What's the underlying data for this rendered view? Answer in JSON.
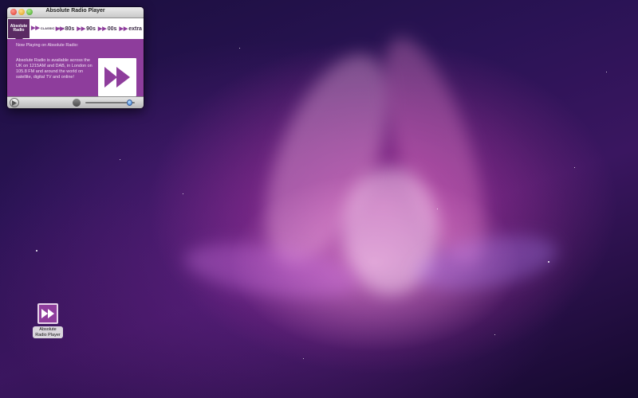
{
  "window": {
    "title": "Absolute Radio Player",
    "logo_text": "Absolute Radio",
    "stations": [
      {
        "label": "CLASSIC ROCK",
        "small": true
      },
      {
        "label": "80s",
        "small": false
      },
      {
        "label": "90s",
        "small": false
      },
      {
        "label": "00s",
        "small": false
      },
      {
        "label": "extra",
        "small": false
      }
    ],
    "now_playing": "Now Playing on Absolute Radio:",
    "description": "Absolute Radio is available across the UK on 1215AM and DAB, in London on 105.8 FM and around the world on satellite, digital TV and online!",
    "volume_level": 0.95
  },
  "desktop_icon": {
    "label_line1": "Absolute",
    "label_line2": "Radio Player"
  },
  "colors": {
    "brand_purple": "#8e3d9c",
    "station_bar": "#ffffff"
  }
}
